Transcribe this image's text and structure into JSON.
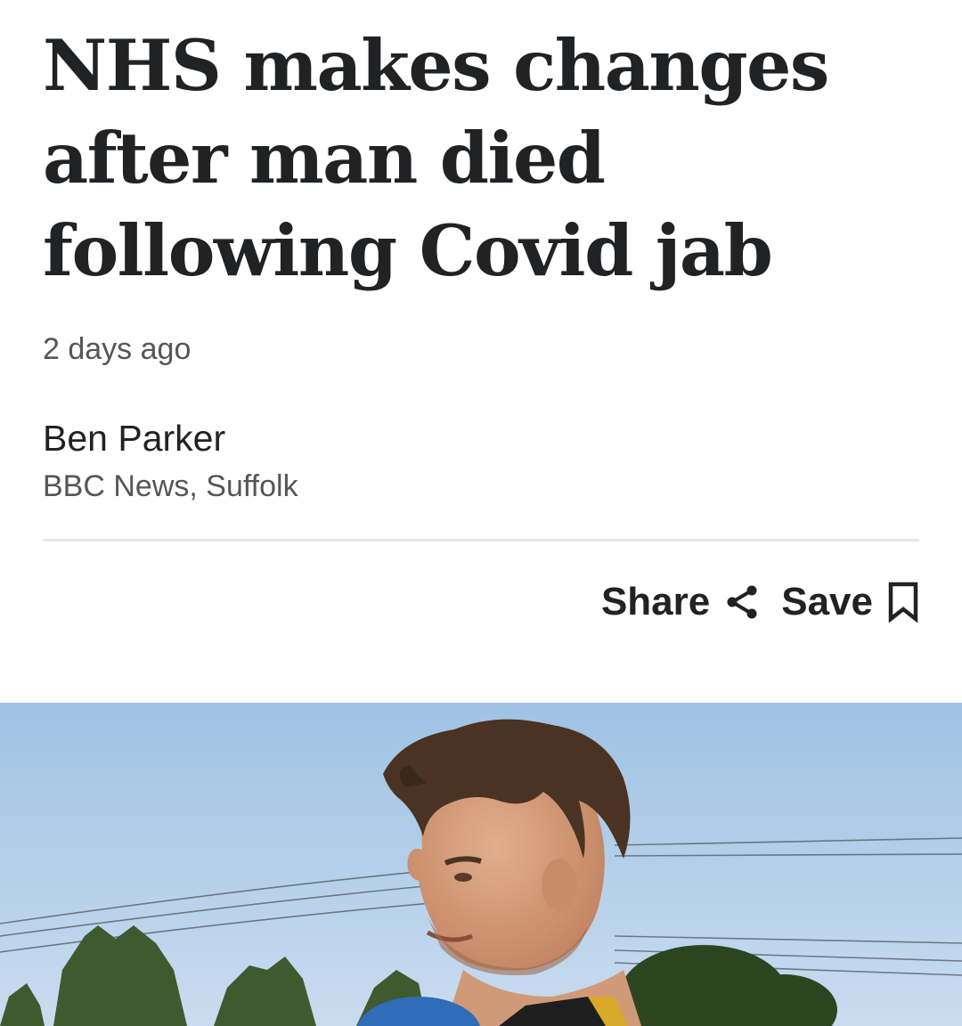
{
  "article": {
    "headline": "NHS makes changes after man died following Covid jab",
    "timestamp": "2 days ago",
    "author": {
      "name": "Ben Parker",
      "organisation": "BBC News, Suffolk"
    },
    "actions": {
      "share_label": "Share",
      "save_label": "Save"
    },
    "hero_image": {
      "subject": "photo of a smiling man with brown hair outdoors under a blue sky, trees and power lines behind him"
    }
  },
  "colors": {
    "text_primary": "#202224",
    "text_secondary": "#545658",
    "divider": "#e6e8ea",
    "sky": "#b7d1ea"
  },
  "icons": [
    "share-icon",
    "bookmark-icon"
  ]
}
